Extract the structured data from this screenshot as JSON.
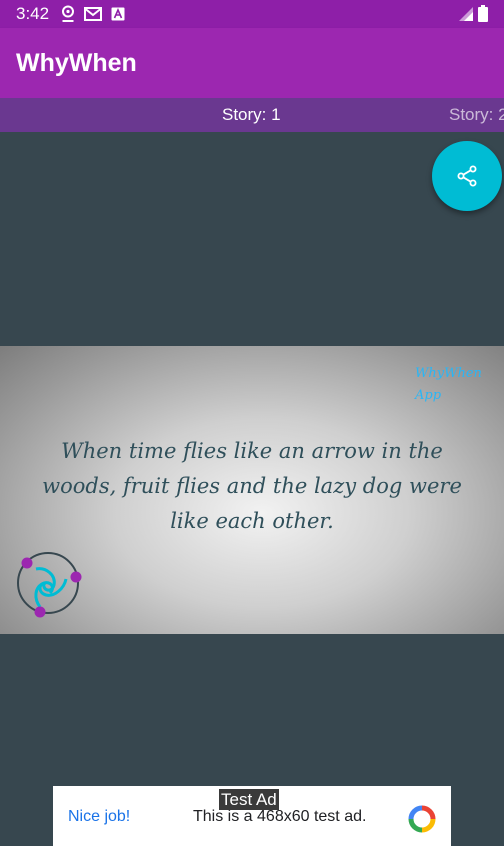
{
  "status_bar": {
    "time": "3:42",
    "icons": [
      "location-pin-icon",
      "gmail-icon",
      "a-icon",
      "signal-icon",
      "battery-icon"
    ]
  },
  "app_bar": {
    "title": "WhyWhen"
  },
  "tabs": [
    {
      "label": "Story: 1",
      "selected": true
    },
    {
      "label": "Story: 2",
      "selected": false
    }
  ],
  "fab": {
    "icon": "share-icon"
  },
  "story": {
    "watermark_line1": "WhyWhen",
    "watermark_line2": "App",
    "quote_line1": "When time flies like an arrow in the",
    "quote_line2": "woods, fruit flies and the lazy dog were",
    "quote_line3": "like each other."
  },
  "ad": {
    "tag": "Test Ad",
    "headline": "Nice job!",
    "body": "This is a 468x60 test ad."
  },
  "colors": {
    "status_bar": "#8e1fa8",
    "app_bar": "#9c27b0",
    "tab_strip": "#6a3890",
    "background": "#37474f",
    "fab": "#00bcd4",
    "quote_text": "#2f4f5a"
  }
}
